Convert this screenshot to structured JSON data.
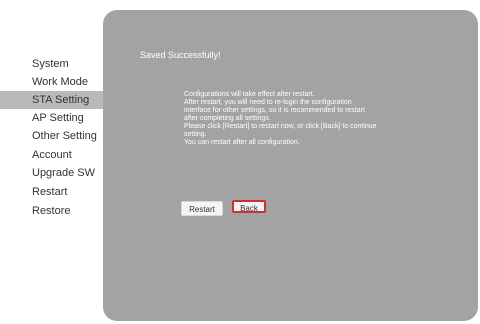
{
  "sidebar": {
    "items": [
      {
        "label": "System"
      },
      {
        "label": "Work Mode"
      },
      {
        "label": "STA Setting",
        "active": true
      },
      {
        "label": "AP Setting"
      },
      {
        "label": "Other Setting"
      },
      {
        "label": "Account"
      },
      {
        "label": "Upgrade SW"
      },
      {
        "label": "Restart"
      },
      {
        "label": "Restore"
      }
    ]
  },
  "main": {
    "status_title": "Saved Successfully!",
    "message_lines": [
      "Configurations will take effect after restart.",
      "After restart, you will need to re-login the configuration",
      "interface for other settings, so it is recommended to restart",
      "after completing all settings.",
      "Please click [Restart] to restart now, or click [Back] to continue",
      "setting.",
      "You can restart after all configuration."
    ],
    "restart_label": "Restart",
    "back_label": "Back"
  },
  "colors": {
    "panel_background": "#a3a3a3",
    "active_nav_background": "#b9b9b9",
    "highlight_border": "#d32f2f"
  }
}
